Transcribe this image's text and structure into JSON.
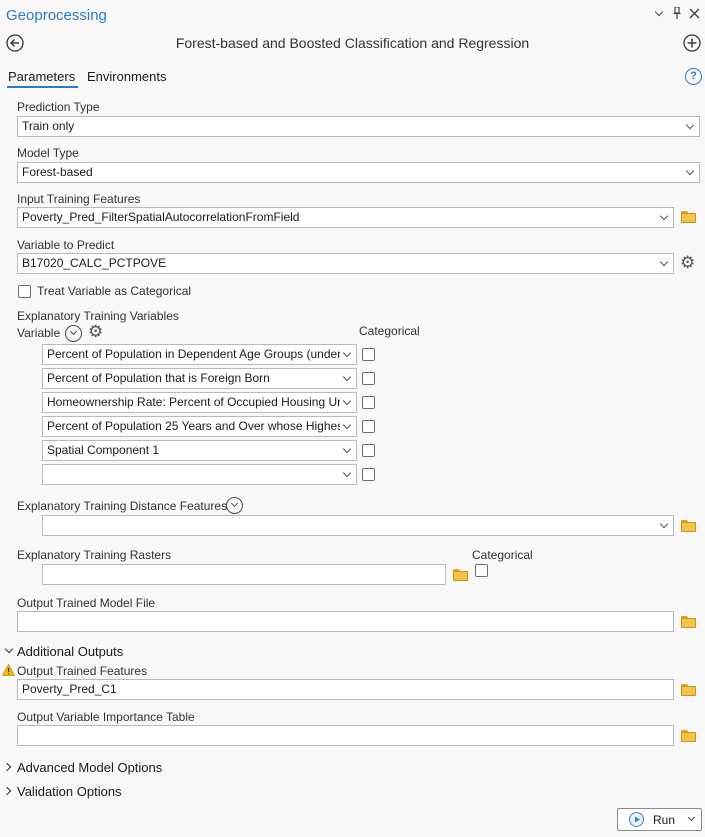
{
  "pane": {
    "title": "Geoprocessing",
    "tool_title": "Forest-based and Boosted Classification and Regression",
    "pin_glyph": "I",
    "close_glyph": "✕"
  },
  "tabs": [
    {
      "label": "Parameters",
      "active": true
    },
    {
      "label": "Environments",
      "active": false
    }
  ],
  "help_glyph": "?",
  "params": {
    "prediction_type": {
      "label": "Prediction Type",
      "value": "Train only"
    },
    "model_type": {
      "label": "Model Type",
      "value": "Forest-based"
    },
    "input_features": {
      "label": "Input Training Features",
      "value": "Poverty_Pred_FilterSpatialAutocorrelationFromField"
    },
    "variable_to_predict": {
      "label": "Variable to Predict",
      "value": "B17020_CALC_PCTPOVE"
    },
    "treat_categorical": {
      "label": "Treat Variable as Categorical",
      "checked": false
    },
    "explanatory": {
      "label": "Explanatory Training Variables",
      "col_variable": "Variable",
      "col_categorical": "Categorical",
      "rows": [
        {
          "value": "Percent of Population in Dependent Age Groups (under",
          "checked": false
        },
        {
          "value": "Percent of Population that is Foreign Born",
          "checked": false
        },
        {
          "value": "Homeownership Rate: Percent of Occupied Housing Ur",
          "checked": false
        },
        {
          "value": "Percent of Population 25 Years and Over whose Highest",
          "checked": false
        },
        {
          "value": "Spatial Component 1",
          "checked": false
        },
        {
          "value": "",
          "checked": false
        }
      ]
    },
    "distance_features": {
      "label": "Explanatory Training Distance Features",
      "value": ""
    },
    "rasters": {
      "label": "Explanatory Training Rasters",
      "col_categorical": "Categorical",
      "value": ""
    },
    "output_model_file": {
      "label": "Output Trained Model File",
      "value": ""
    }
  },
  "additional_outputs": {
    "heading": "Additional Outputs",
    "trained_features": {
      "label": "Output Trained Features",
      "value": "Poverty_Pred_C1"
    },
    "importance_table": {
      "label": "Output Variable Importance Table",
      "value": ""
    }
  },
  "collapsed_sections": [
    {
      "label": "Advanced Model Options"
    },
    {
      "label": "Validation Options"
    }
  ],
  "run_button": {
    "label": "Run"
  },
  "colors": {
    "accent": "#2d7bc4",
    "warning": "#e8a317"
  }
}
